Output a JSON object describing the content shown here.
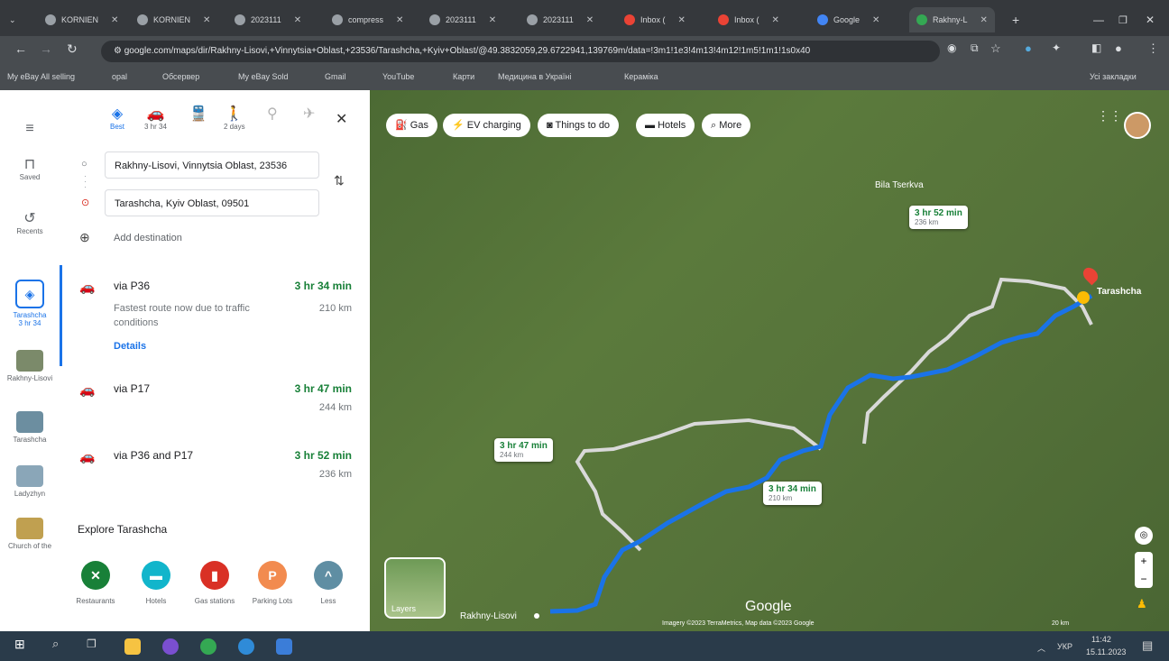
{
  "browser": {
    "tabs": [
      {
        "label": "KORNIEN",
        "active": false
      },
      {
        "label": "KORNIEN",
        "active": false
      },
      {
        "label": "2023111",
        "active": false
      },
      {
        "label": "compress",
        "active": false
      },
      {
        "label": "2023111",
        "active": false
      },
      {
        "label": "2023111",
        "active": false
      },
      {
        "label": "Inbox (",
        "active": false
      },
      {
        "label": "Inbox (",
        "active": false
      },
      {
        "label": "Google",
        "active": false
      },
      {
        "label": "Rakhny-L",
        "active": true
      }
    ],
    "url": "google.com/maps/dir/Rakhny-Lisovi,+Vinnytsia+Oblast,+23536/Tarashcha,+Kyiv+Oblast/@49.3832059,29.6722941,139769m/data=!3m1!1e3!4m13!4m12!1m5!1m1!1s0x40",
    "bookmarks": [
      "My eBay All selling",
      "opal",
      "Обсервер",
      "My eBay Sold",
      "Gmail",
      "YouTube",
      "Карти",
      "Медицина в Україні",
      "Кераміка"
    ],
    "bookmarks_right": "Усі закладки"
  },
  "rail": {
    "menu_icon": "menu-icon",
    "items": [
      {
        "label": "Saved",
        "icon": "bookmark-icon"
      },
      {
        "label": "Recents",
        "icon": "history-icon"
      },
      {
        "label": "Tarashcha\n3 hr 34",
        "icon": "directions-icon"
      },
      {
        "label": "Rakhny-Lisovi",
        "icon": "place-thumbnail"
      },
      {
        "label": "Tarashcha",
        "icon": "place-thumbnail"
      },
      {
        "label": "Ladyzhyn",
        "icon": "place-thumbnail"
      },
      {
        "label": "Church of the",
        "icon": "place-thumbnail"
      }
    ]
  },
  "directions": {
    "modes": [
      {
        "name": "best",
        "label": "Best",
        "icon": "directions-icon"
      },
      {
        "name": "car",
        "label": "3 hr 34",
        "icon": "car-icon"
      },
      {
        "name": "transit",
        "label": "",
        "icon": "train-icon"
      },
      {
        "name": "walk",
        "label": "2 days",
        "icon": "walk-icon"
      },
      {
        "name": "bike",
        "label": "",
        "icon": "bike-icon"
      },
      {
        "name": "flight",
        "label": "",
        "icon": "plane-icon"
      }
    ],
    "origin": "Rakhny-Lisovi, Vinnytsia Oblast, 23536",
    "destination": "Tarashcha, Kyiv Oblast, 09501",
    "add_destination": "Add destination",
    "routes": [
      {
        "via": "via P36",
        "time": "3 hr 34 min",
        "distance": "210 km",
        "note": "Fastest route now due to traffic conditions",
        "details": "Details"
      },
      {
        "via": "via P17",
        "time": "3 hr 47 min",
        "distance": "244 km"
      },
      {
        "via": "via P36 and P17",
        "time": "3 hr 52 min",
        "distance": "236 km"
      }
    ],
    "explore_title": "Explore Tarashcha",
    "explore": [
      {
        "label": "Restaurants",
        "color": "#188038",
        "glyph": "🍴"
      },
      {
        "label": "Hotels",
        "color": "#12b5cb",
        "glyph": "🛏"
      },
      {
        "label": "Gas stations",
        "color": "#d93025",
        "glyph": "⛽"
      },
      {
        "label": "Parking Lots",
        "color": "#f28b4f",
        "glyph": "P"
      },
      {
        "label": "Less",
        "color": "#5f8ea3",
        "glyph": "^"
      }
    ]
  },
  "map": {
    "chips": [
      {
        "label": "Gas",
        "icon": "gas-icon"
      },
      {
        "label": "EV charging",
        "icon": "ev-icon"
      },
      {
        "label": "Things to do",
        "icon": "camera-icon"
      },
      {
        "label": "Hotels",
        "icon": "hotel-icon"
      },
      {
        "label": "More",
        "icon": "search-icon"
      }
    ],
    "callouts": [
      {
        "time": "3 hr 52 min",
        "distance": "236 km"
      },
      {
        "time": "3 hr 47 min",
        "distance": "244 km"
      },
      {
        "time": "3 hr 34 min",
        "distance": "210 km"
      }
    ],
    "places": [
      "Tarashcha",
      "Bila Tserkva",
      "Rakhny-Lisovi"
    ],
    "layers_label": "Layers",
    "logo": "Google",
    "attribution": "Imagery ©2023 TerraMetrics, Map data ©2023 Google",
    "scale": "20 km"
  },
  "taskbar": {
    "lang": "УКР",
    "time": "11:42",
    "date": "15.11.2023"
  },
  "colors": {
    "route_main": "#1a73e8",
    "route_alt": "#d9d9d9",
    "accent_green": "#188038"
  }
}
